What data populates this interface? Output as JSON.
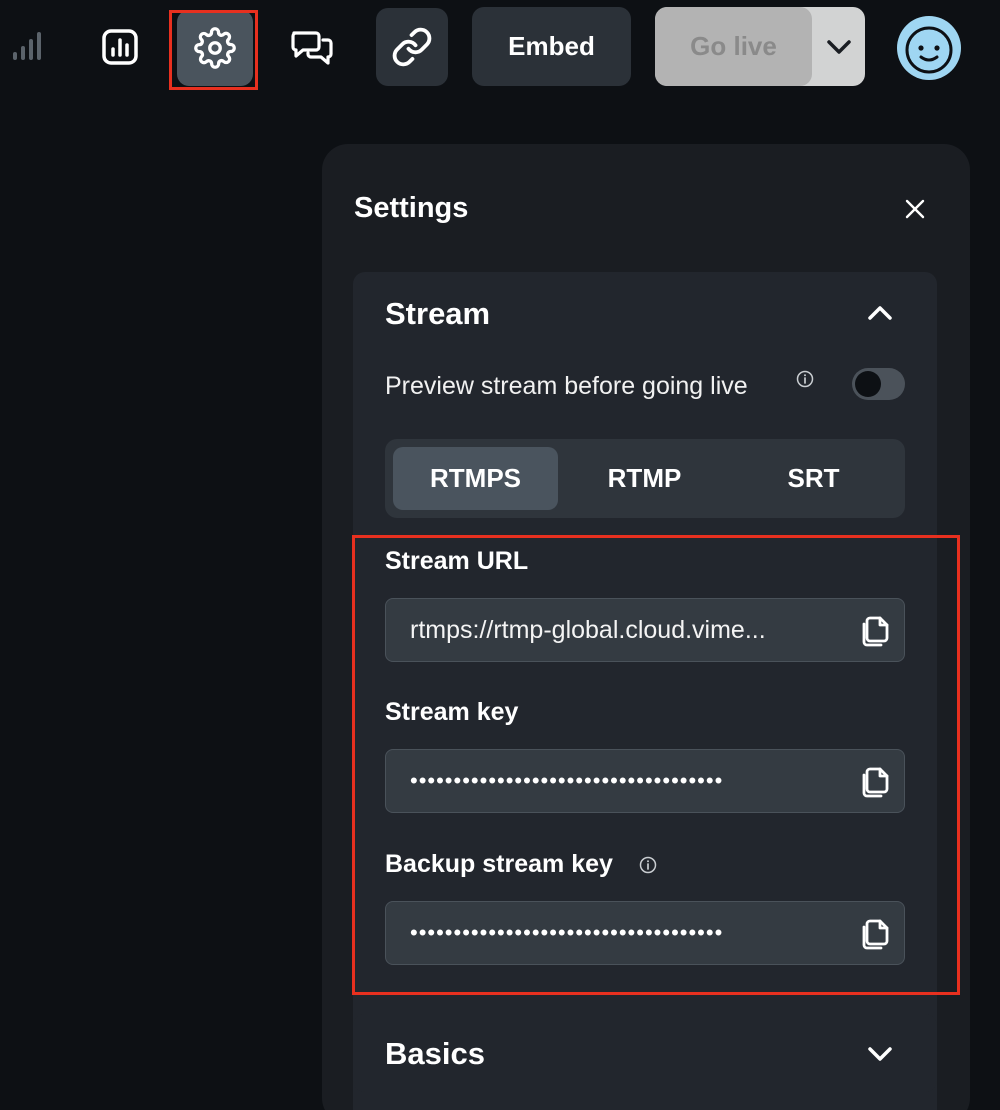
{
  "toolbar": {
    "icons": {
      "signal": "signal-strength-icon",
      "analytics": "analytics-icon",
      "settings": "gear-icon",
      "chat": "chat-icon",
      "link": "link-icon",
      "avatar": "user-avatar"
    },
    "embed_label": "Embed",
    "golive_label": "Go live"
  },
  "settings": {
    "title": "Settings",
    "stream": {
      "title": "Stream",
      "expanded": true,
      "preview_label": "Preview stream before going live",
      "preview_enabled": false,
      "protocols": [
        "RTMPS",
        "RTMP",
        "SRT"
      ],
      "selected_protocol": "RTMPS",
      "url_label": "Stream URL",
      "url_value": "rtmps://rtmp-global.cloud.vime...",
      "key_label": "Stream key",
      "key_value": "••••••••••••••••••••••••••••••••••••",
      "backup_label": "Backup stream key",
      "backup_value": "••••••••••••••••••••••••••••••••••••"
    },
    "basics": {
      "title": "Basics",
      "expanded": false
    }
  },
  "colors": {
    "background": "#0d1014",
    "panel": "#1a1d22",
    "section": "#22262d",
    "highlight": "#e8301f",
    "avatar": "#9fd6f2"
  }
}
